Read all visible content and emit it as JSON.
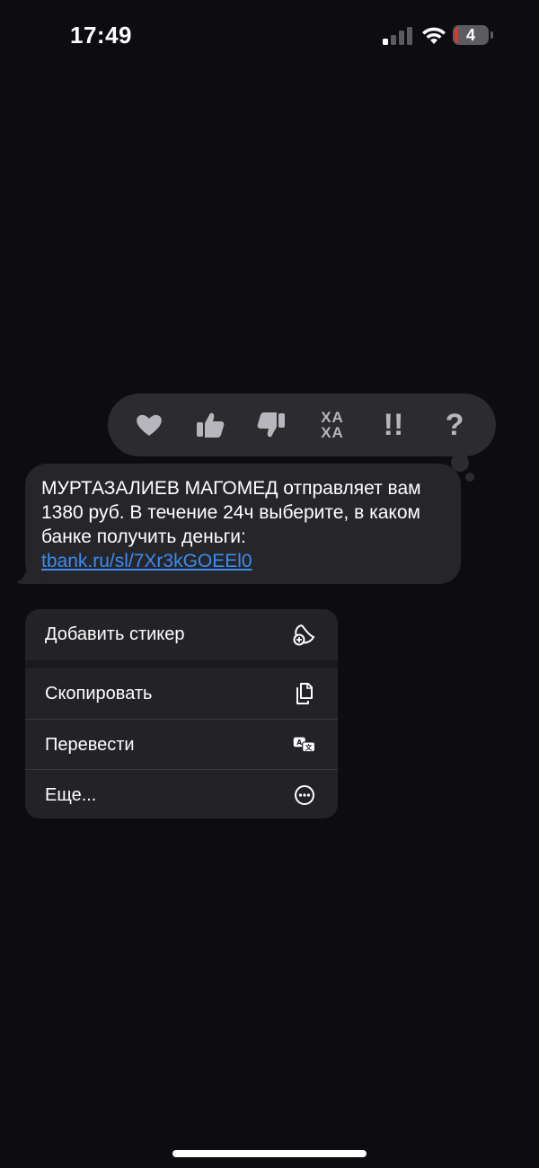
{
  "status_bar": {
    "time": "17:49",
    "battery_level": "4",
    "icons": [
      "signal-icon",
      "wifi-icon",
      "battery-icon"
    ]
  },
  "tapback": {
    "items": [
      {
        "name": "heart",
        "icon": "heart-icon"
      },
      {
        "name": "thumbs-up",
        "icon": "thumbs-up-icon"
      },
      {
        "name": "thumbs-down",
        "icon": "thumbs-down-icon"
      },
      {
        "name": "haha",
        "label_line1": "ХА",
        "label_line2": "ХА"
      },
      {
        "name": "emphasize",
        "label": "!!"
      },
      {
        "name": "question",
        "label": "?"
      }
    ]
  },
  "message": {
    "text": "МУРТАЗАЛИЕВ МАГОМЕД отправляет вам 1380 руб. В течение 24ч выберите, в каком банке получить деньги:",
    "link": "tbank.ru/sl/7Xr3kGOEEl0"
  },
  "context_menu": {
    "items": [
      {
        "label": "Добавить стикер",
        "icon": "add-sticker-icon"
      },
      {
        "label": "Скопировать",
        "icon": "copy-icon"
      },
      {
        "label": "Перевести",
        "icon": "translate-icon"
      },
      {
        "label": "Еще...",
        "icon": "more-icon"
      }
    ]
  },
  "colors": {
    "background": "#0d0c10",
    "bubble": "#262529",
    "link": "#3b8df4",
    "menu": "#232226",
    "tapback": "#2c2b30",
    "battery_low": "#e5332a"
  }
}
